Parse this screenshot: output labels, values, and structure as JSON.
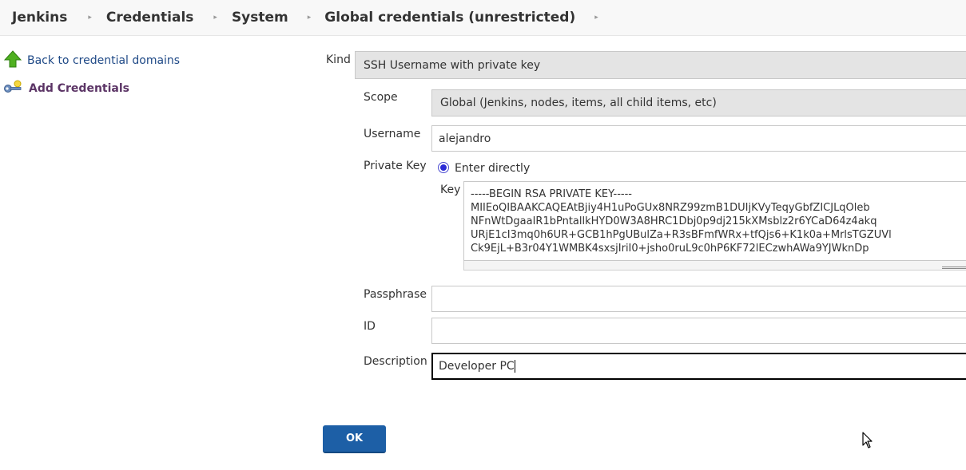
{
  "breadcrumb": {
    "items": [
      "Jenkins",
      "Credentials",
      "System",
      "Global credentials (unrestricted)"
    ]
  },
  "sidebar": {
    "back_label": "Back to credential domains",
    "add_label": "Add Credentials"
  },
  "form": {
    "kind_label": "Kind",
    "kind_value": "SSH Username with private key",
    "scope_label": "Scope",
    "scope_value": "Global (Jenkins, nodes, items, all child items, etc)",
    "username_label": "Username",
    "username_value": "alejandro",
    "private_key_label": "Private Key",
    "enter_directly_label": "Enter directly",
    "key_label": "Key",
    "key_value": "-----BEGIN RSA PRIVATE KEY-----\nMIIEoQIBAAKCAQEAtBjiy4H1uPoGUx8NRZ99zmB1DUIjKVyTeqyGbfZICJLqOleb\nNFnWtDgaaIR1bPntallkHYD0W3A8HRC1Dbj0p9dj215kXMsblz2r6YCaD64z4akq\nURjE1cI3mq0h6UR+GCB1hPgUBulZa+R3sBFmfWRx+tfQjs6+K1k0a+MrlsTGZUVl\nCk9EjL+B3r04Y1WMBK4sxsjIriI0+jsho0ruL9c0hP6KF72lECzwhAWa9YJWknDp",
    "passphrase_label": "Passphrase",
    "passphrase_value": "",
    "id_label": "ID",
    "id_value": "",
    "description_label": "Description",
    "description_value": "Developer PC"
  },
  "ok_label": "OK",
  "colors": {
    "ok_button": "#1d5fa6",
    "back_link": "#204a87",
    "add_link": "#5c3566",
    "select_bg": "#e4e4e4"
  }
}
